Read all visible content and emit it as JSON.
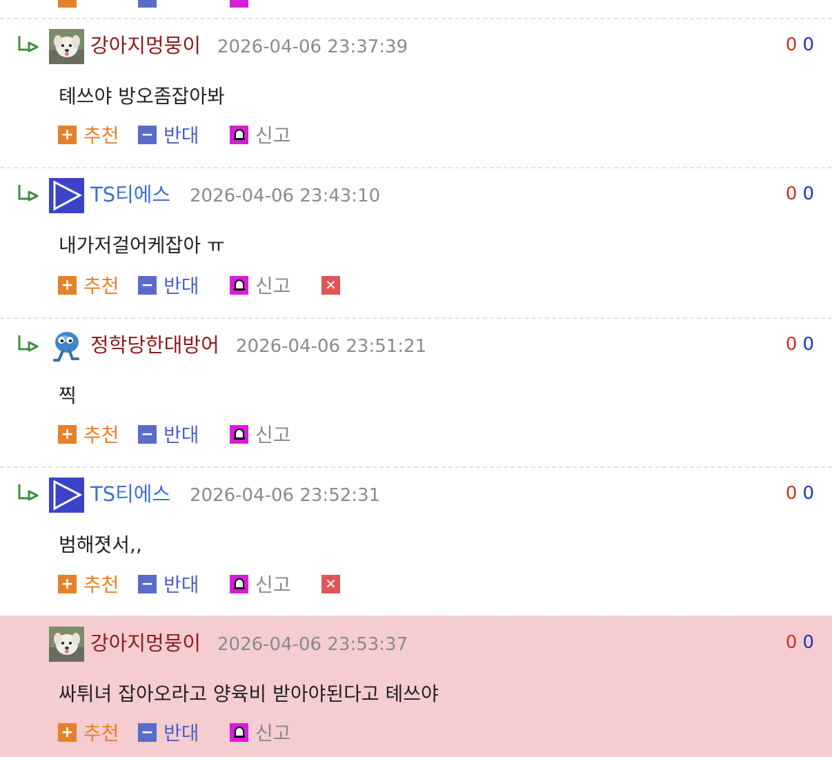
{
  "labels": {
    "recommend": "추천",
    "oppose": "반대",
    "report": "신고"
  },
  "comments": [
    {
      "author": "강아지멍뭉이",
      "date": "2026-04-06 23:37:39",
      "text": "톄쓰야 방오좀잡아봐",
      "up": "0",
      "down": "0",
      "avatar": "puppy-avatar"
    },
    {
      "author": "TS티에스",
      "date": "2026-04-06 23:43:10",
      "text": "내가저걸어케잡아 ㅠ",
      "up": "0",
      "down": "0",
      "avatar": "play-triangle-avatar"
    },
    {
      "author": "정학당한대방어",
      "date": "2026-04-06 23:51:21",
      "text": "찍",
      "up": "0",
      "down": "0",
      "avatar": "blue-blob-avatar"
    },
    {
      "author": "TS티에스",
      "date": "2026-04-06 23:52:31",
      "text": "범해졋서,,",
      "up": "0",
      "down": "0",
      "avatar": "play-triangle-avatar"
    },
    {
      "author": "강아지멍뭉이",
      "date": "2026-04-06 23:53:37",
      "text": "싸튀녀 잡아오라고 양육비 받아야된다고 톄쓰야",
      "up": "0",
      "down": "0",
      "avatar": "puppy-avatar"
    }
  ],
  "colors": {
    "author_dark": "#8b1a1a",
    "author_blue": "#3a6fd8",
    "highlight_bg": "#f5cccf",
    "recommend": "#e5812a",
    "oppose": "#5a6bc9",
    "report": "#d61ed6",
    "delete": "#e05555",
    "vote_up": "#d62b1f",
    "vote_down": "#1c33c4"
  }
}
